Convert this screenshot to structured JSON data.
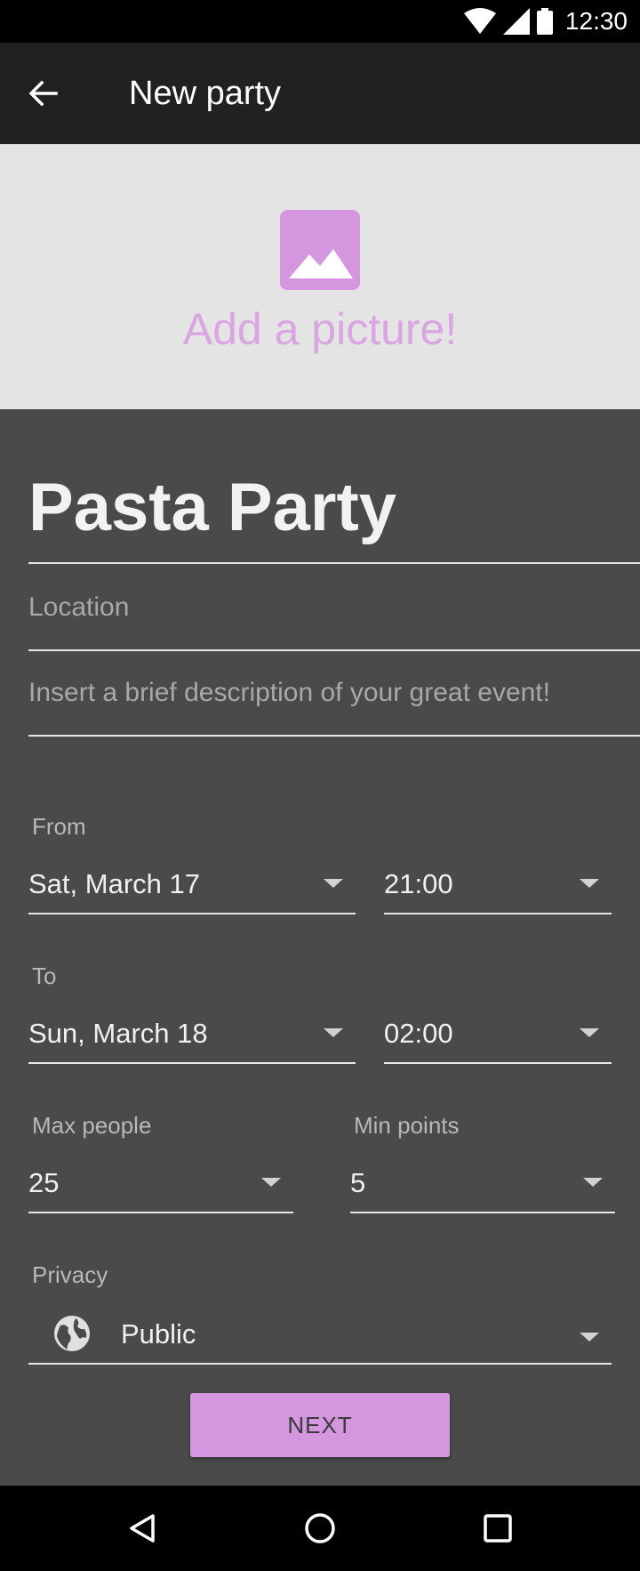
{
  "status_bar": {
    "time": "12:30",
    "icons": [
      "wifi-icon",
      "signal-icon",
      "battery-icon"
    ]
  },
  "app_bar": {
    "title": "New party",
    "back_icon": "arrow-back-icon"
  },
  "picture": {
    "label": "Add a picture!",
    "icon": "image-icon"
  },
  "form": {
    "title_value": "Pasta Party",
    "location_placeholder": "Location",
    "description_placeholder": "Insert a brief description of your great event!",
    "from": {
      "label": "From",
      "date": "Sat, March 17",
      "time": "21:00"
    },
    "to": {
      "label": "To",
      "date": "Sun, March 18",
      "time": "02:00"
    },
    "max_people": {
      "label": "Max people",
      "value": "25"
    },
    "min_points": {
      "label": "Min points",
      "value": "5"
    },
    "privacy": {
      "label": "Privacy",
      "value": "Public",
      "icon": "globe-icon"
    },
    "next_label": "NEXT"
  },
  "nav_bar": {
    "icons": [
      "back-triangle-icon",
      "home-circle-icon",
      "recents-square-icon"
    ]
  },
  "colors": {
    "accent": "#d496de",
    "app_bar": "#212121",
    "background": "#4a4a4a",
    "picture_bg": "#e4e4e4"
  }
}
